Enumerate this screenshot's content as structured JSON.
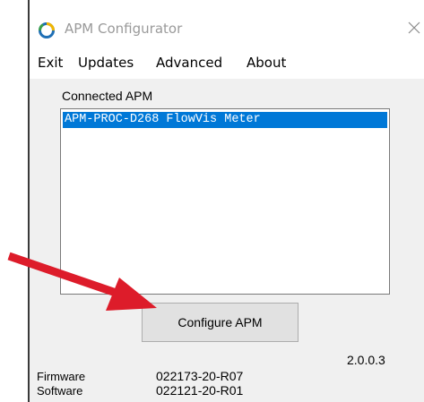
{
  "window": {
    "title": "APM Configurator",
    "close_glyph": "✕"
  },
  "menu": [
    {
      "label": "Exit"
    },
    {
      "label": "Updates"
    },
    {
      "label": "Advanced"
    },
    {
      "label": "About"
    }
  ],
  "connected": {
    "label": "Connected APM",
    "items": [
      "APM-PROC-D268 FlowVis Meter"
    ],
    "selected_index": 0
  },
  "configure_button": {
    "label": "Configure APM"
  },
  "version": "2.0.0.3",
  "info": {
    "firmware_label": "Firmware",
    "firmware_value": "022173-20-R07",
    "software_label": "Software",
    "software_value": "022121-20-R01"
  },
  "colors": {
    "selection": "#0078d7",
    "arrow": "#dd1c2a",
    "client_bg": "#f0f0f0"
  },
  "icons": {
    "app": "app-logo-icon",
    "close": "close-icon",
    "annotation": "red-arrow-annotation"
  }
}
